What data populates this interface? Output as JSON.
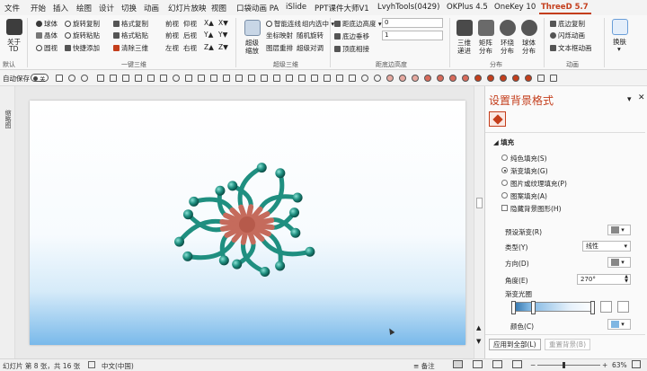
{
  "menubar": {
    "items": [
      "文件",
      "开始",
      "插入",
      "绘图",
      "设计",
      "切换",
      "动画",
      "幻灯片放映",
      "视图",
      "口袋动画 PA",
      "iSlide",
      "PPT课件大师V1",
      "LvyhTools(0429)",
      "OKPlus 4.5",
      "OneKey 10",
      "ThreeD 5.7"
    ],
    "active": "ThreeD 5.7"
  },
  "ribbon": {
    "about": {
      "line1": "关于",
      "line2": "TD",
      "group": "默认"
    },
    "yijian": {
      "col1": [
        "球体",
        "晶体",
        "圆视"
      ],
      "col2": [
        "旋转复制",
        "旋转粘贴",
        "快捷添加"
      ],
      "col3": [
        "格式复制",
        "格式粘贴",
        "清除三维"
      ],
      "views": [
        [
          "前视",
          "仰视",
          "X▲",
          "X▼"
        ],
        [
          "前视",
          "后视",
          "Y▲",
          "Y▼"
        ],
        [
          "左视",
          "右视",
          "Z▲",
          "Z▼"
        ]
      ],
      "group": "一键三维"
    },
    "chaoji": {
      "big_label1": "超级",
      "big_label2": "缩放",
      "items": [
        "智能连线",
        "组内选中",
        "坐标映射",
        "随机旋转",
        "图层重排",
        "超级对调"
      ],
      "group": "超级三维"
    },
    "distance": {
      "label1": "距底边高度",
      "value1": "0",
      "label2": "底边垂移",
      "value2": "1",
      "label3": "顶底相接",
      "group": "距底边高度"
    },
    "fenbu": {
      "items": [
        [
          "三维",
          "递进"
        ],
        [
          "矩阵",
          "分布"
        ],
        [
          "环绕",
          "分布"
        ],
        [
          "球体",
          "分布"
        ]
      ],
      "group": "分布"
    },
    "anim": {
      "items": [
        "底边复制",
        "闪烁动画",
        "文本框动画"
      ],
      "group": "动画"
    },
    "skin": {
      "line1": "换肤",
      "line2": "▾"
    }
  },
  "toolbar": {
    "autosave": "自动保存",
    "toggle": "关"
  },
  "left_strip": {
    "label": "缩略图"
  },
  "pane": {
    "title": "设置背景格式",
    "section": "填充",
    "fill_options": [
      "纯色填充(S)",
      "渐变填充(G)",
      "图片或纹理填充(P)",
      "图案填充(A)"
    ],
    "selected_fill": "渐变填充(G)",
    "hide_bg": "隐藏背景图形(H)",
    "preset_label": "预设渐变(R)",
    "type_label": "类型(Y)",
    "type_value": "线性",
    "direction_label": "方向(D)",
    "angle_label": "角度(E)",
    "angle_value": "270°",
    "stops_label": "渐变光圈",
    "color_label": "颜色(C)",
    "apply_all": "应用到全部(L)",
    "reset": "重置背景(B)"
  },
  "status": {
    "slide_info": "幻灯片 第 8 张，共 16 张",
    "language": "中文(中国)",
    "notes": "备注",
    "zoom": "63%"
  },
  "colors": {
    "accent": "#c43e1c",
    "teal": "#1f8f80",
    "coral": "#c56b5c"
  }
}
